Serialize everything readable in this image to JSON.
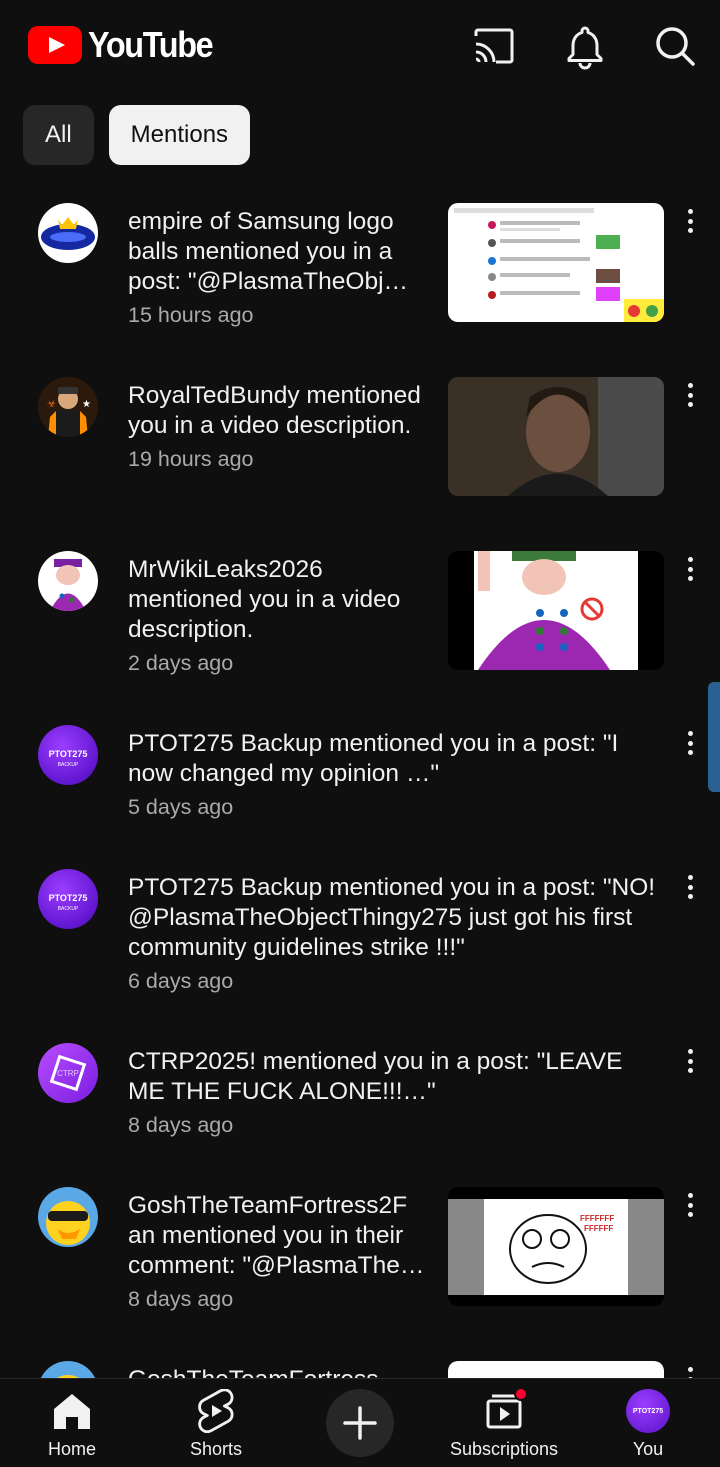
{
  "header": {
    "logo_text": "YouTube",
    "icons": [
      "cast-icon",
      "bell-icon",
      "search-icon"
    ]
  },
  "chips": [
    {
      "label": "All",
      "selected": false
    },
    {
      "label": "Mentions",
      "selected": true
    }
  ],
  "notifications": [
    {
      "message": "empire of Samsung logo balls  mentioned you in a post: \"@PlasmaTheObj…",
      "time": "15 hours ago",
      "has_thumbnail": true
    },
    {
      "message": "RoyalTedBundy mentioned you in a video description.",
      "time": "19 hours ago",
      "has_thumbnail": true
    },
    {
      "message": "MrWikiLeaks2026 mentioned you in a video description.",
      "time": "2 days ago",
      "has_thumbnail": true
    },
    {
      "message": "PTOT275 Backup mentioned you in a post: \"I now changed my opinion …\"",
      "time": "5 days ago",
      "has_thumbnail": false
    },
    {
      "message": "PTOT275 Backup mentioned you in a post: \"NO! @PlasmaTheObjectThingy275 just got his first community guidelines strike !!!\"",
      "time": "6 days ago",
      "has_thumbnail": false
    },
    {
      "message": "CTRP2025! mentioned you in a post: \"LEAVE ME THE FUCK ALONE!!!…\"",
      "time": "8 days ago",
      "has_thumbnail": false
    },
    {
      "message": "GoshTheTeamFortress2F an mentioned you in their comment: \"@PlasmaThe…",
      "time": "8 days ago",
      "has_thumbnail": true
    },
    {
      "message": "GoshTheTeamFortress",
      "time": "",
      "has_thumbnail": true
    }
  ],
  "avatar_text": {
    "ptot": "PTOT275",
    "ptot_sub": "BACKUP",
    "ctrp": "CTRP",
    "thumb_rage": "FFFFFFF\nFFFFFF"
  },
  "bottom_nav": {
    "home": "Home",
    "shorts": "Shorts",
    "create": "Create",
    "subscriptions": "Subscriptions",
    "you": "You",
    "you_avatar_text": "PTOT275"
  },
  "colors": {
    "background": "#0f0f0f",
    "brand_red": "#ff0000",
    "chip_selected": "#f1f1f1",
    "chip_unselected": "#272727",
    "secondary_text": "#aaaaaa",
    "ptot_purple": "#7b1fe0"
  }
}
